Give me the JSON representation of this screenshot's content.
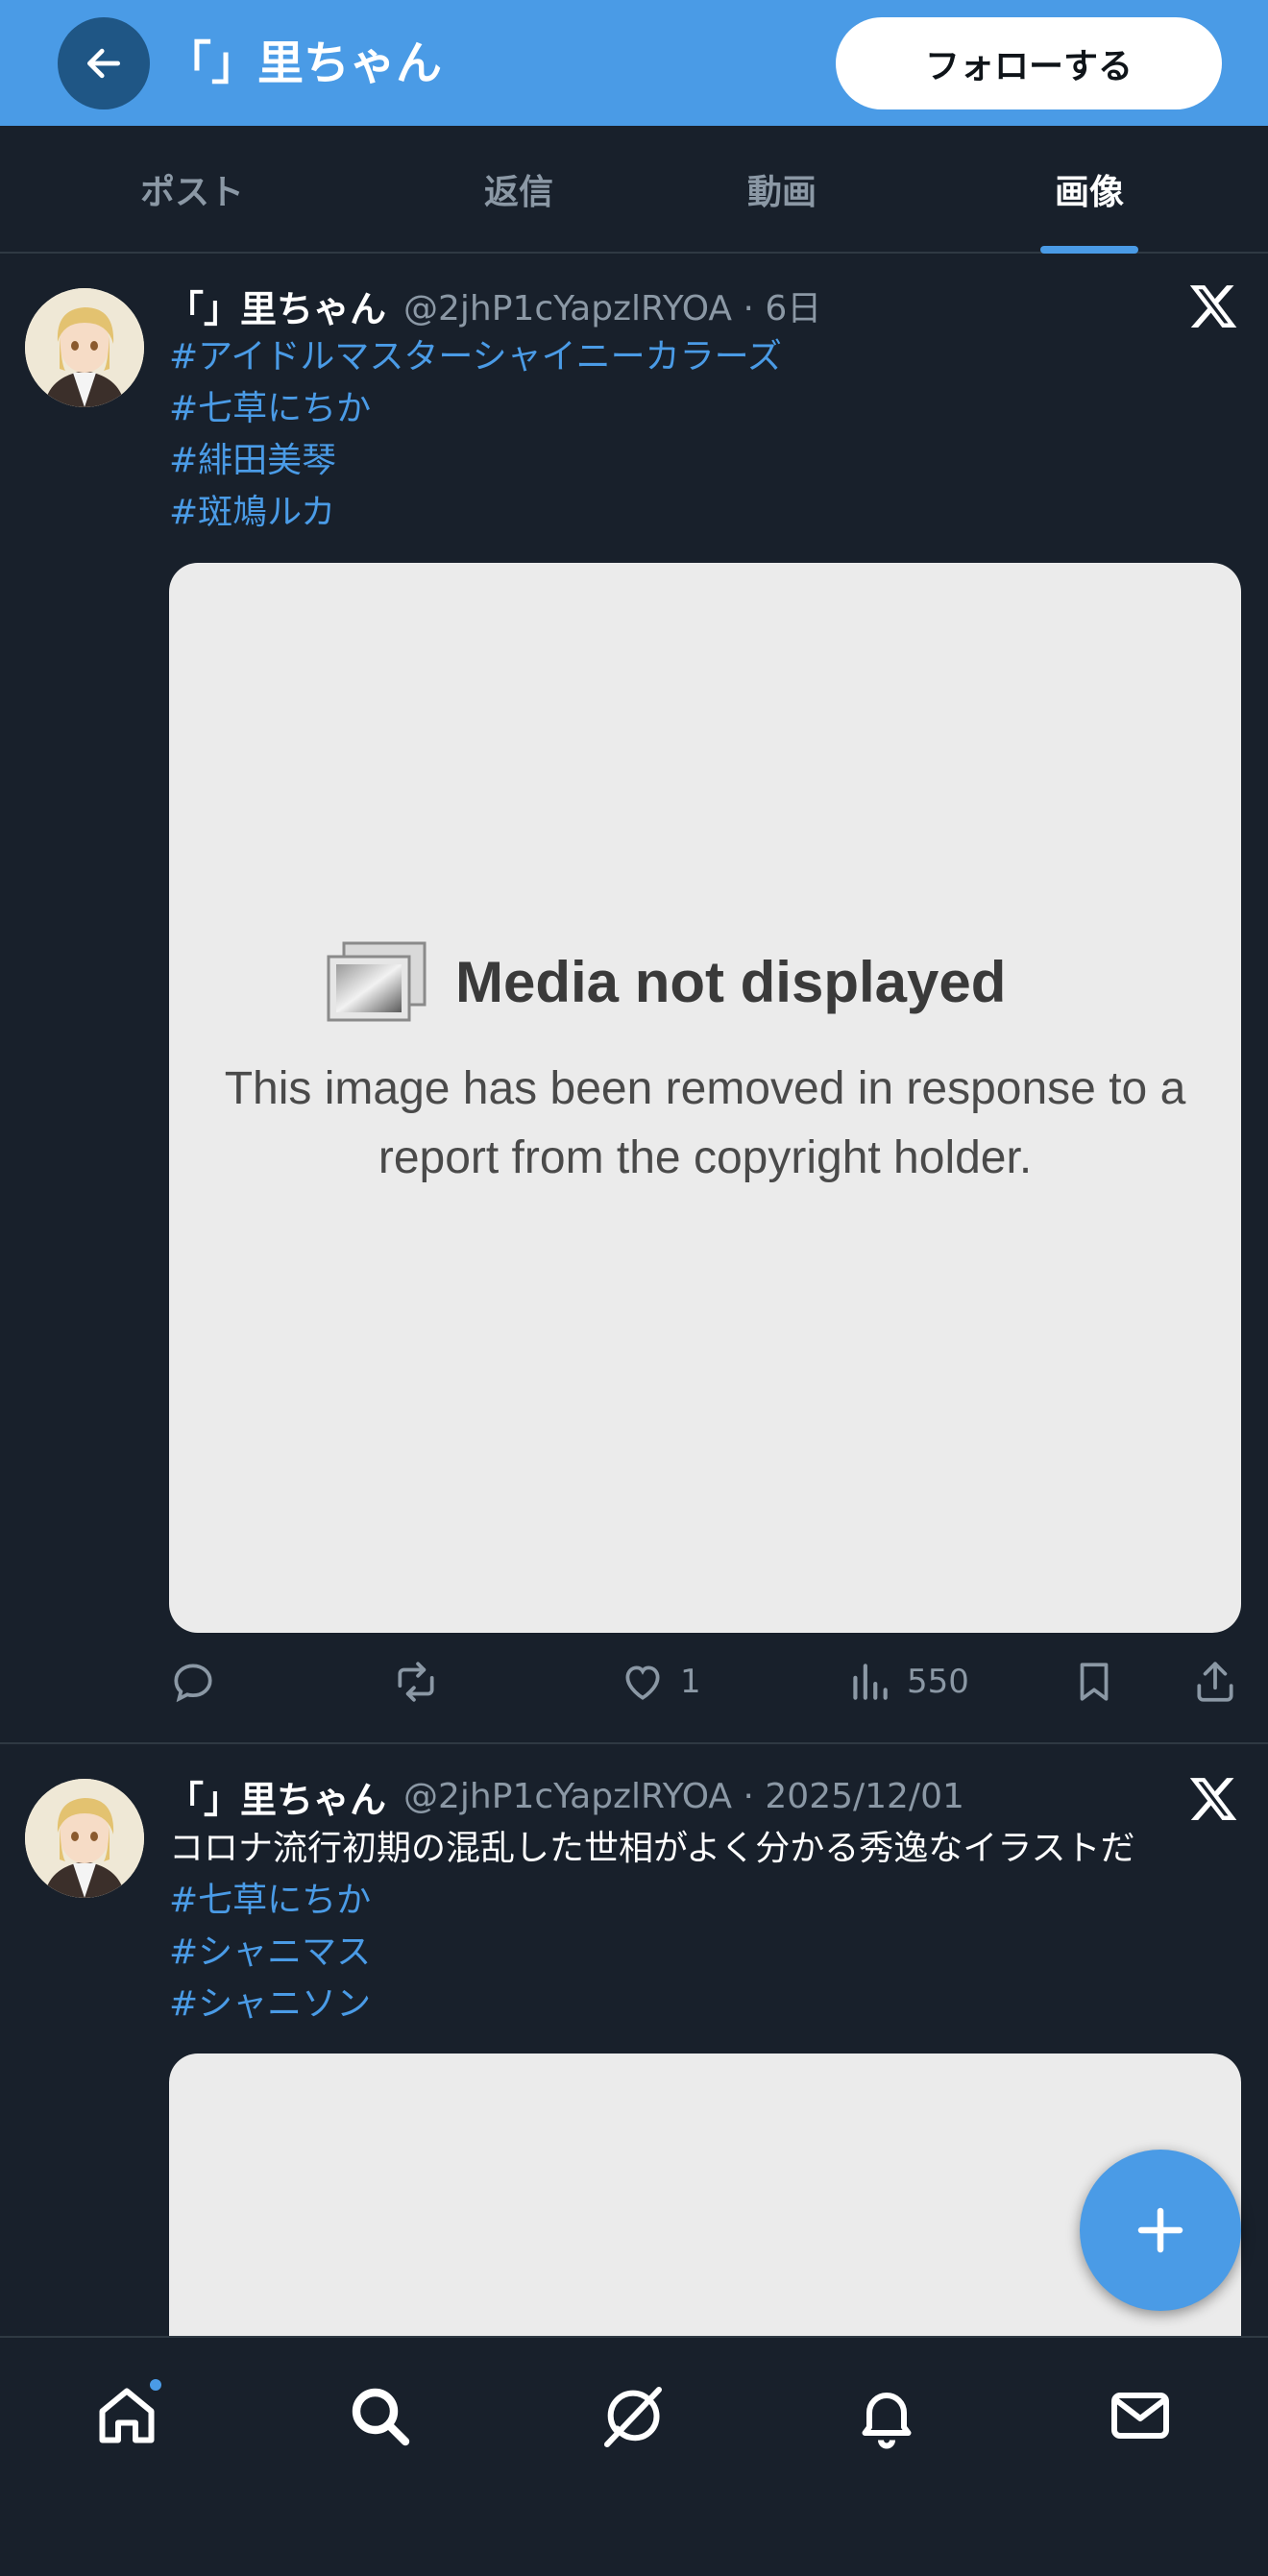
{
  "header": {
    "title": "「」里ちゃん",
    "follow_label": "フォローする",
    "back_icon": "arrow-left-icon"
  },
  "tabs": [
    {
      "label": "ポスト",
      "active": false
    },
    {
      "label": "返信",
      "active": false
    },
    {
      "label": "動画",
      "active": false
    },
    {
      "label": "画像",
      "active": true
    }
  ],
  "posts": [
    {
      "name": "「」里ちゃん",
      "handle": "@2jhP1cYapzlRYOA · 6日",
      "text": "",
      "hashtags": [
        "#アイドルマスターシャイニーカラーズ",
        "#七草にちか",
        "#緋田美琴",
        "#斑鳩ルカ"
      ],
      "media": {
        "title": "Media not displayed",
        "line1": "This image has been removed in response to a",
        "line2": "report from the copyright holder."
      },
      "likes": "1",
      "views": "550"
    },
    {
      "name": "「」里ちゃん",
      "handle": "@2jhP1cYapzlRYOA · 2025/12/01",
      "text": "コロナ流行初期の混乱した世相がよく分かる秀逸なイラストだ",
      "hashtags": [
        "#七草にちか",
        "#シャニマス",
        "#シャニソン"
      ]
    }
  ],
  "colors": {
    "accent": "#4a9be6",
    "background": "#18202b",
    "text_secondary": "#8b98a5"
  },
  "nav": [
    "home-icon",
    "search-icon",
    "grok-icon",
    "bell-icon",
    "mail-icon"
  ]
}
